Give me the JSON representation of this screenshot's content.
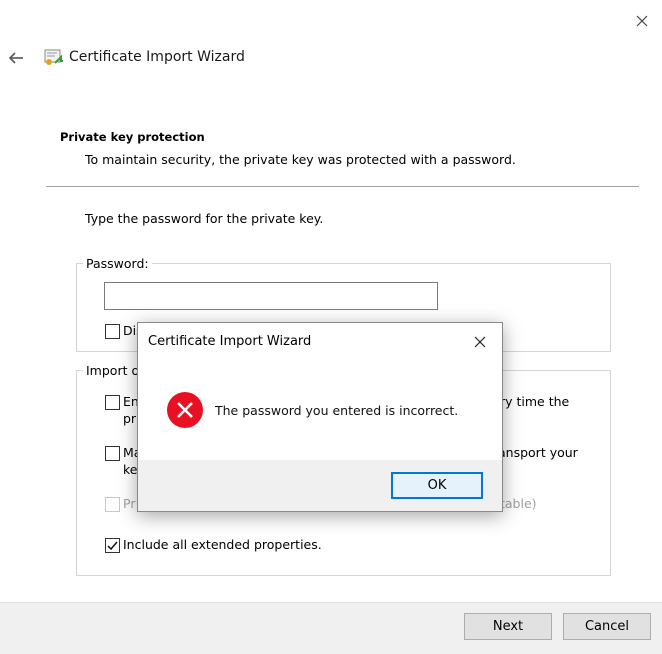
{
  "window": {
    "title": "Certificate Import Wizard",
    "close_icon": "close-icon",
    "back_icon": "back-arrow-icon",
    "app_icon": "certificate-icon"
  },
  "section": {
    "heading": "Private key protection",
    "description": "To maintain security, the private key was protected with a password."
  },
  "prompt": "Type the password for the private key.",
  "password_group": {
    "legend": "Password:",
    "input_value": "",
    "display_password_label_visible": "Dis"
  },
  "import_group": {
    "legend_visible": "Import o",
    "options": [
      {
        "label_visible_left": "En",
        "label_visible_left2": "pri",
        "label_visible_right": "ry time the",
        "checked": false,
        "enabled": true
      },
      {
        "label_visible_left": "Ma",
        "label_visible_left2": "ke",
        "label_visible_right": "ansport your",
        "checked": false,
        "enabled": true
      },
      {
        "label_visible_left": "Pr",
        "label_visible_right": "table)",
        "checked": false,
        "enabled": false
      },
      {
        "label": "Include all extended properties.",
        "checked": true,
        "enabled": true
      }
    ]
  },
  "footer": {
    "next_label": "Next",
    "cancel_label": "Cancel"
  },
  "dialog": {
    "title": "Certificate Import Wizard",
    "message": "The password you entered is incorrect.",
    "ok_label": "OK",
    "icon": "error-icon",
    "close_icon": "close-icon"
  },
  "colors": {
    "error_red": "#e81123",
    "accent_blue": "#0078d7",
    "footer_gray": "#f0f0f0"
  }
}
